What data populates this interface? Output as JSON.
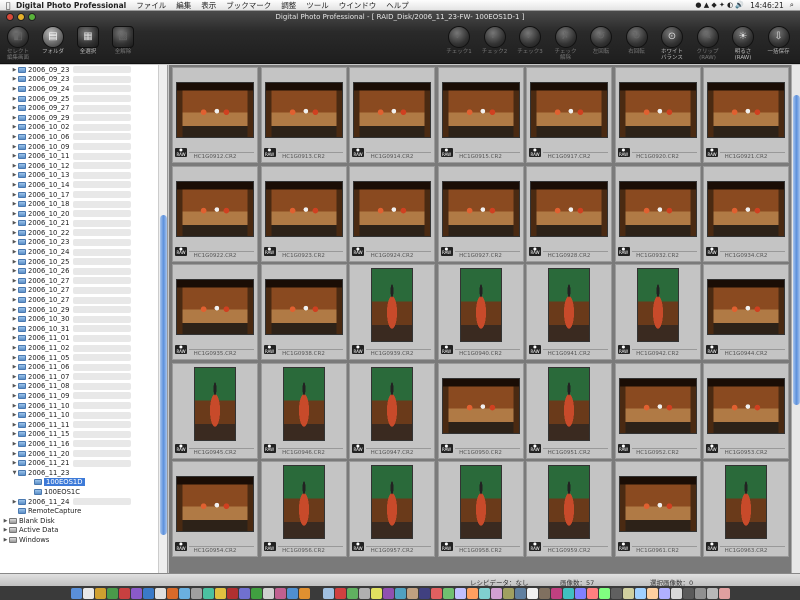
{
  "menubar": {
    "app_name": "Digital Photo Professional",
    "menus": [
      "ファイル",
      "編集",
      "表示",
      "ブックマーク",
      "調整",
      "ツール",
      "ウインドウ",
      "ヘルプ"
    ],
    "clock": "14:46:21"
  },
  "window": {
    "title": "Digital Photo Professional - [ RAID_Disk/2006_11_23-FW-          100EOS1D-1 ]"
  },
  "toolbar": {
    "left": [
      {
        "label": "セレクト\n編集画面",
        "icon": "select-edit-icon",
        "state": "dim"
      },
      {
        "label": "フォルダ",
        "icon": "folder-icon",
        "state": "active"
      },
      {
        "label": "全選択",
        "icon": "select-all-icon",
        "state": "normal"
      },
      {
        "label": "全解除",
        "icon": "deselect-all-icon",
        "state": "dim"
      }
    ],
    "right": [
      {
        "label": "チェック1",
        "icon": "check1-icon",
        "state": "dim"
      },
      {
        "label": "チェック2",
        "icon": "check2-icon",
        "state": "dim"
      },
      {
        "label": "チェック3",
        "icon": "check3-icon",
        "state": "dim"
      },
      {
        "label": "チェック\n解除",
        "icon": "check-clear-icon",
        "state": "dim"
      },
      {
        "label": "左回転",
        "icon": "rotate-left-icon",
        "state": "dim"
      },
      {
        "label": "右回転",
        "icon": "rotate-right-icon",
        "state": "dim"
      },
      {
        "label": "ホワイト\nバランス",
        "icon": "white-balance-icon",
        "state": "normal"
      },
      {
        "label": "クリップ\n(RAW)",
        "icon": "clip-icon",
        "state": "dim"
      },
      {
        "label": "明るさ\n(RAW)",
        "icon": "brightness-icon",
        "state": "normal"
      },
      {
        "label": "一括保存",
        "icon": "batch-save-icon",
        "state": "normal"
      }
    ]
  },
  "tree": [
    {
      "label": "2006_09_23",
      "kind": "folder"
    },
    {
      "label": "2006_09_23",
      "kind": "folder"
    },
    {
      "label": "2006_09_24",
      "kind": "folder"
    },
    {
      "label": "2006_09_25",
      "kind": "folder"
    },
    {
      "label": "2006_09_27",
      "kind": "folder"
    },
    {
      "label": "2006_09_29",
      "kind": "folder"
    },
    {
      "label": "2006_10_02",
      "kind": "folder"
    },
    {
      "label": "2006_10_06",
      "kind": "folder"
    },
    {
      "label": "2006_10_09",
      "kind": "folder"
    },
    {
      "label": "2006_10_11",
      "kind": "folder"
    },
    {
      "label": "2006_10_12",
      "kind": "folder"
    },
    {
      "label": "2006_10_13",
      "kind": "folder"
    },
    {
      "label": "2006_10_14",
      "kind": "folder"
    },
    {
      "label": "2006_10_17",
      "kind": "folder"
    },
    {
      "label": "2006_10_18",
      "kind": "folder"
    },
    {
      "label": "2006_10_20",
      "kind": "folder"
    },
    {
      "label": "2006_10_21",
      "kind": "folder"
    },
    {
      "label": "2006_10_22",
      "kind": "folder"
    },
    {
      "label": "2006_10_23",
      "kind": "folder"
    },
    {
      "label": "2006_10_24",
      "kind": "folder"
    },
    {
      "label": "2006_10_25",
      "kind": "folder"
    },
    {
      "label": "2006_10_26",
      "kind": "folder"
    },
    {
      "label": "2006_10_27",
      "kind": "folder"
    },
    {
      "label": "2006_10_27",
      "kind": "folder"
    },
    {
      "label": "2006_10_27",
      "kind": "folder"
    },
    {
      "label": "2006_10_29",
      "kind": "folder"
    },
    {
      "label": "2006_10_30",
      "kind": "folder"
    },
    {
      "label": "2006_10_31",
      "kind": "folder"
    },
    {
      "label": "2006_11_01",
      "kind": "folder"
    },
    {
      "label": "2006_11_02",
      "kind": "folder"
    },
    {
      "label": "2006_11_05",
      "kind": "folder"
    },
    {
      "label": "2006_11_06",
      "kind": "folder"
    },
    {
      "label": "2006_11_07",
      "kind": "folder"
    },
    {
      "label": "2006_11_08",
      "kind": "folder"
    },
    {
      "label": "2006_11_09",
      "kind": "folder"
    },
    {
      "label": "2006_11_10",
      "kind": "folder"
    },
    {
      "label": "2006_11_10",
      "kind": "folder"
    },
    {
      "label": "2006_11_11",
      "kind": "folder"
    },
    {
      "label": "2006_11_15",
      "kind": "folder"
    },
    {
      "label": "2006_11_16",
      "kind": "folder"
    },
    {
      "label": "2006_11_20",
      "kind": "folder"
    },
    {
      "label": "2006_11_21",
      "kind": "folder"
    },
    {
      "label": "2006_11_23",
      "kind": "folder",
      "expanded": true
    },
    {
      "label": "100EOS1D",
      "kind": "subfolder",
      "selected": true
    },
    {
      "label": "100EOS1C",
      "kind": "subfolder"
    },
    {
      "label": "2006_11_24",
      "kind": "folder"
    },
    {
      "label": "RemoteCapture",
      "kind": "folder",
      "notri": true
    },
    {
      "label": "Blank Disk",
      "kind": "drive"
    },
    {
      "label": "Active Data",
      "kind": "drive"
    },
    {
      "label": "Windows",
      "kind": "drive"
    }
  ],
  "thumbnails": [
    {
      "file": "HC1G0912.CR2",
      "orient": "l"
    },
    {
      "file": "HC1G0913.CR2",
      "orient": "l"
    },
    {
      "file": "HC1G0914.CR2",
      "orient": "l"
    },
    {
      "file": "HC1G0915.CR2",
      "orient": "l"
    },
    {
      "file": "HC1G0917.CR2",
      "orient": "l"
    },
    {
      "file": "HC1G0920.CR2",
      "orient": "l"
    },
    {
      "file": "HC1G0921.CR2",
      "orient": "l"
    },
    {
      "file": "HC1G0922.CR2",
      "orient": "l"
    },
    {
      "file": "HC1G0923.CR2",
      "orient": "l"
    },
    {
      "file": "HC1G0924.CR2",
      "orient": "l"
    },
    {
      "file": "HC1G0927.CR2",
      "orient": "l"
    },
    {
      "file": "HC1G0928.CR2",
      "orient": "l"
    },
    {
      "file": "HC1G0932.CR2",
      "orient": "l"
    },
    {
      "file": "HC1G0934.CR2",
      "orient": "l"
    },
    {
      "file": "HC1G0935.CR2",
      "orient": "l"
    },
    {
      "file": "HC1G0938.CR2",
      "orient": "l"
    },
    {
      "file": "HC1G0939.CR2",
      "orient": "p"
    },
    {
      "file": "HC1G0940.CR2",
      "orient": "p"
    },
    {
      "file": "HC1G0941.CR2",
      "orient": "p"
    },
    {
      "file": "HC1G0942.CR2",
      "orient": "p"
    },
    {
      "file": "HC1G0944.CR2",
      "orient": "l"
    },
    {
      "file": "HC1G0945.CR2",
      "orient": "p"
    },
    {
      "file": "HC1G0946.CR2",
      "orient": "p"
    },
    {
      "file": "HC1G0947.CR2",
      "orient": "p"
    },
    {
      "file": "HC1G0950.CR2",
      "orient": "l"
    },
    {
      "file": "HC1G0951.CR2",
      "orient": "p"
    },
    {
      "file": "HC1G0952.CR2",
      "orient": "l"
    },
    {
      "file": "HC1G0953.CR2",
      "orient": "l"
    },
    {
      "file": "HC1G0954.CR2",
      "orient": "l"
    },
    {
      "file": "HC1G0956.CR2",
      "orient": "p"
    },
    {
      "file": "HC1G0957.CR2",
      "orient": "p"
    },
    {
      "file": "HC1G0958.CR2",
      "orient": "p"
    },
    {
      "file": "HC1G0959.CR2",
      "orient": "p"
    },
    {
      "file": "HC1G0961.CR2",
      "orient": "l"
    },
    {
      "file": "HC1G0963.CR2",
      "orient": "p"
    }
  ],
  "status": {
    "recipe": "レシピデータ：なし",
    "image_count": "画像数：57",
    "selected_count": "選択画像数：0"
  },
  "colors": {
    "selection": "#3d7ad8",
    "toolbar_bg": "#2a2a2a"
  }
}
